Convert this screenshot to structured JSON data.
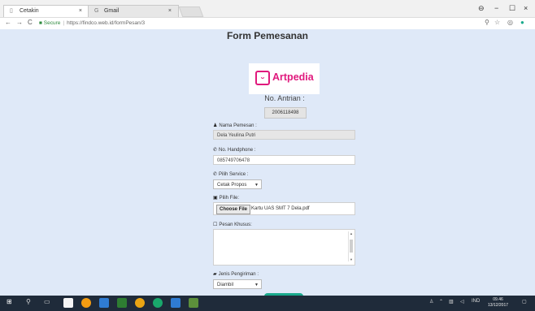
{
  "browser": {
    "tabs": [
      {
        "label": "Cetakin",
        "close": "×"
      },
      {
        "label": "Gmail",
        "close": "×"
      }
    ],
    "window_controls": {
      "account": "⊖",
      "minimize": "−",
      "maximize": "☐",
      "close": "×"
    },
    "nav": {
      "back": "←",
      "forward": "→",
      "reload": "C"
    },
    "address": {
      "secure_label": "Secure",
      "url": "https://findco.web.id/formPesan/3"
    },
    "toolbar_icons": {
      "zoom": "⚲",
      "star": "☆",
      "ext1": "◎",
      "ext2": "●"
    }
  },
  "page": {
    "title": "Form Pemesanan",
    "logo": {
      "brand": "Artpedia"
    },
    "queue": {
      "label": "No. Antrian :",
      "value": "2006118498"
    },
    "fields": {
      "nama": {
        "label": "Nama Pemesan :",
        "value": "Dela Yeulina Putri"
      },
      "hp": {
        "label": "No. Handphone :",
        "value": "085749706478"
      },
      "service": {
        "label": "Pilih Service :",
        "value": "Cetak Propos"
      },
      "file": {
        "label": "Pilih File:",
        "button": "Choose File",
        "filename": "Kartu UAS SMT 7 Dela.pdf"
      },
      "pesan": {
        "label": "Pesan Khusus:",
        "value": ""
      },
      "pengiriman": {
        "label": "Jenis Pengiriman :",
        "value": "Diambil"
      }
    }
  },
  "taskbar": {
    "tray": {
      "ime": "IND",
      "time": "09.46",
      "date": "13/12/2017"
    }
  },
  "colors": {
    "accent": "#e0197d",
    "submit": "#1aaa8d",
    "page_bg": "#dfe9f8",
    "taskbar": "#1f2b3a"
  }
}
